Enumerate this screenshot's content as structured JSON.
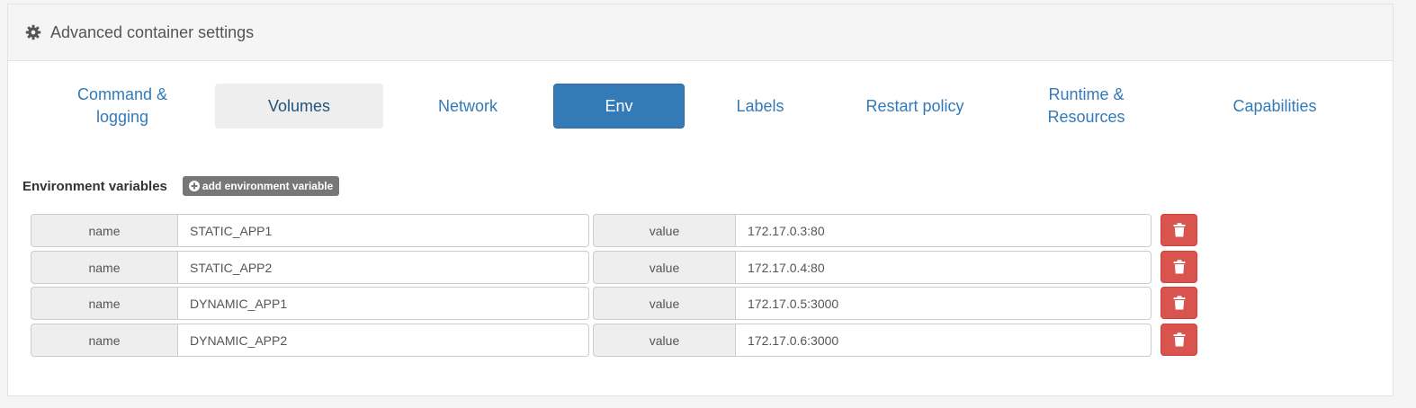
{
  "panel": {
    "title": "Advanced container settings",
    "header_icon": "gear-icon"
  },
  "tabs": [
    {
      "label": "Command & logging",
      "state": "default"
    },
    {
      "label": "Volumes",
      "state": "hover"
    },
    {
      "label": "Network",
      "state": "default"
    },
    {
      "label": "Env",
      "state": "active"
    },
    {
      "label": "Labels",
      "state": "default"
    },
    {
      "label": "Restart policy",
      "state": "default"
    },
    {
      "label": "Runtime & Resources",
      "state": "default"
    },
    {
      "label": "Capabilities",
      "state": "default"
    }
  ],
  "env": {
    "section_label": "Environment variables",
    "add_button_label": "add environment variable",
    "add_button_icon": "plus-circle-icon",
    "name_addon": "name",
    "value_addon": "value",
    "delete_icon": "trash-icon",
    "variables": [
      {
        "name": "STATIC_APP1",
        "value": "172.17.0.3:80"
      },
      {
        "name": "STATIC_APP2",
        "value": "172.17.0.4:80"
      },
      {
        "name": "DYNAMIC_APP1",
        "value": "172.17.0.5:3000"
      },
      {
        "name": "DYNAMIC_APP2",
        "value": "172.17.0.6:3000"
      }
    ]
  },
  "colors": {
    "primary": "#337ab7",
    "danger": "#d9534f",
    "label_grey": "#777777",
    "header_bg": "#f5f5f5"
  }
}
